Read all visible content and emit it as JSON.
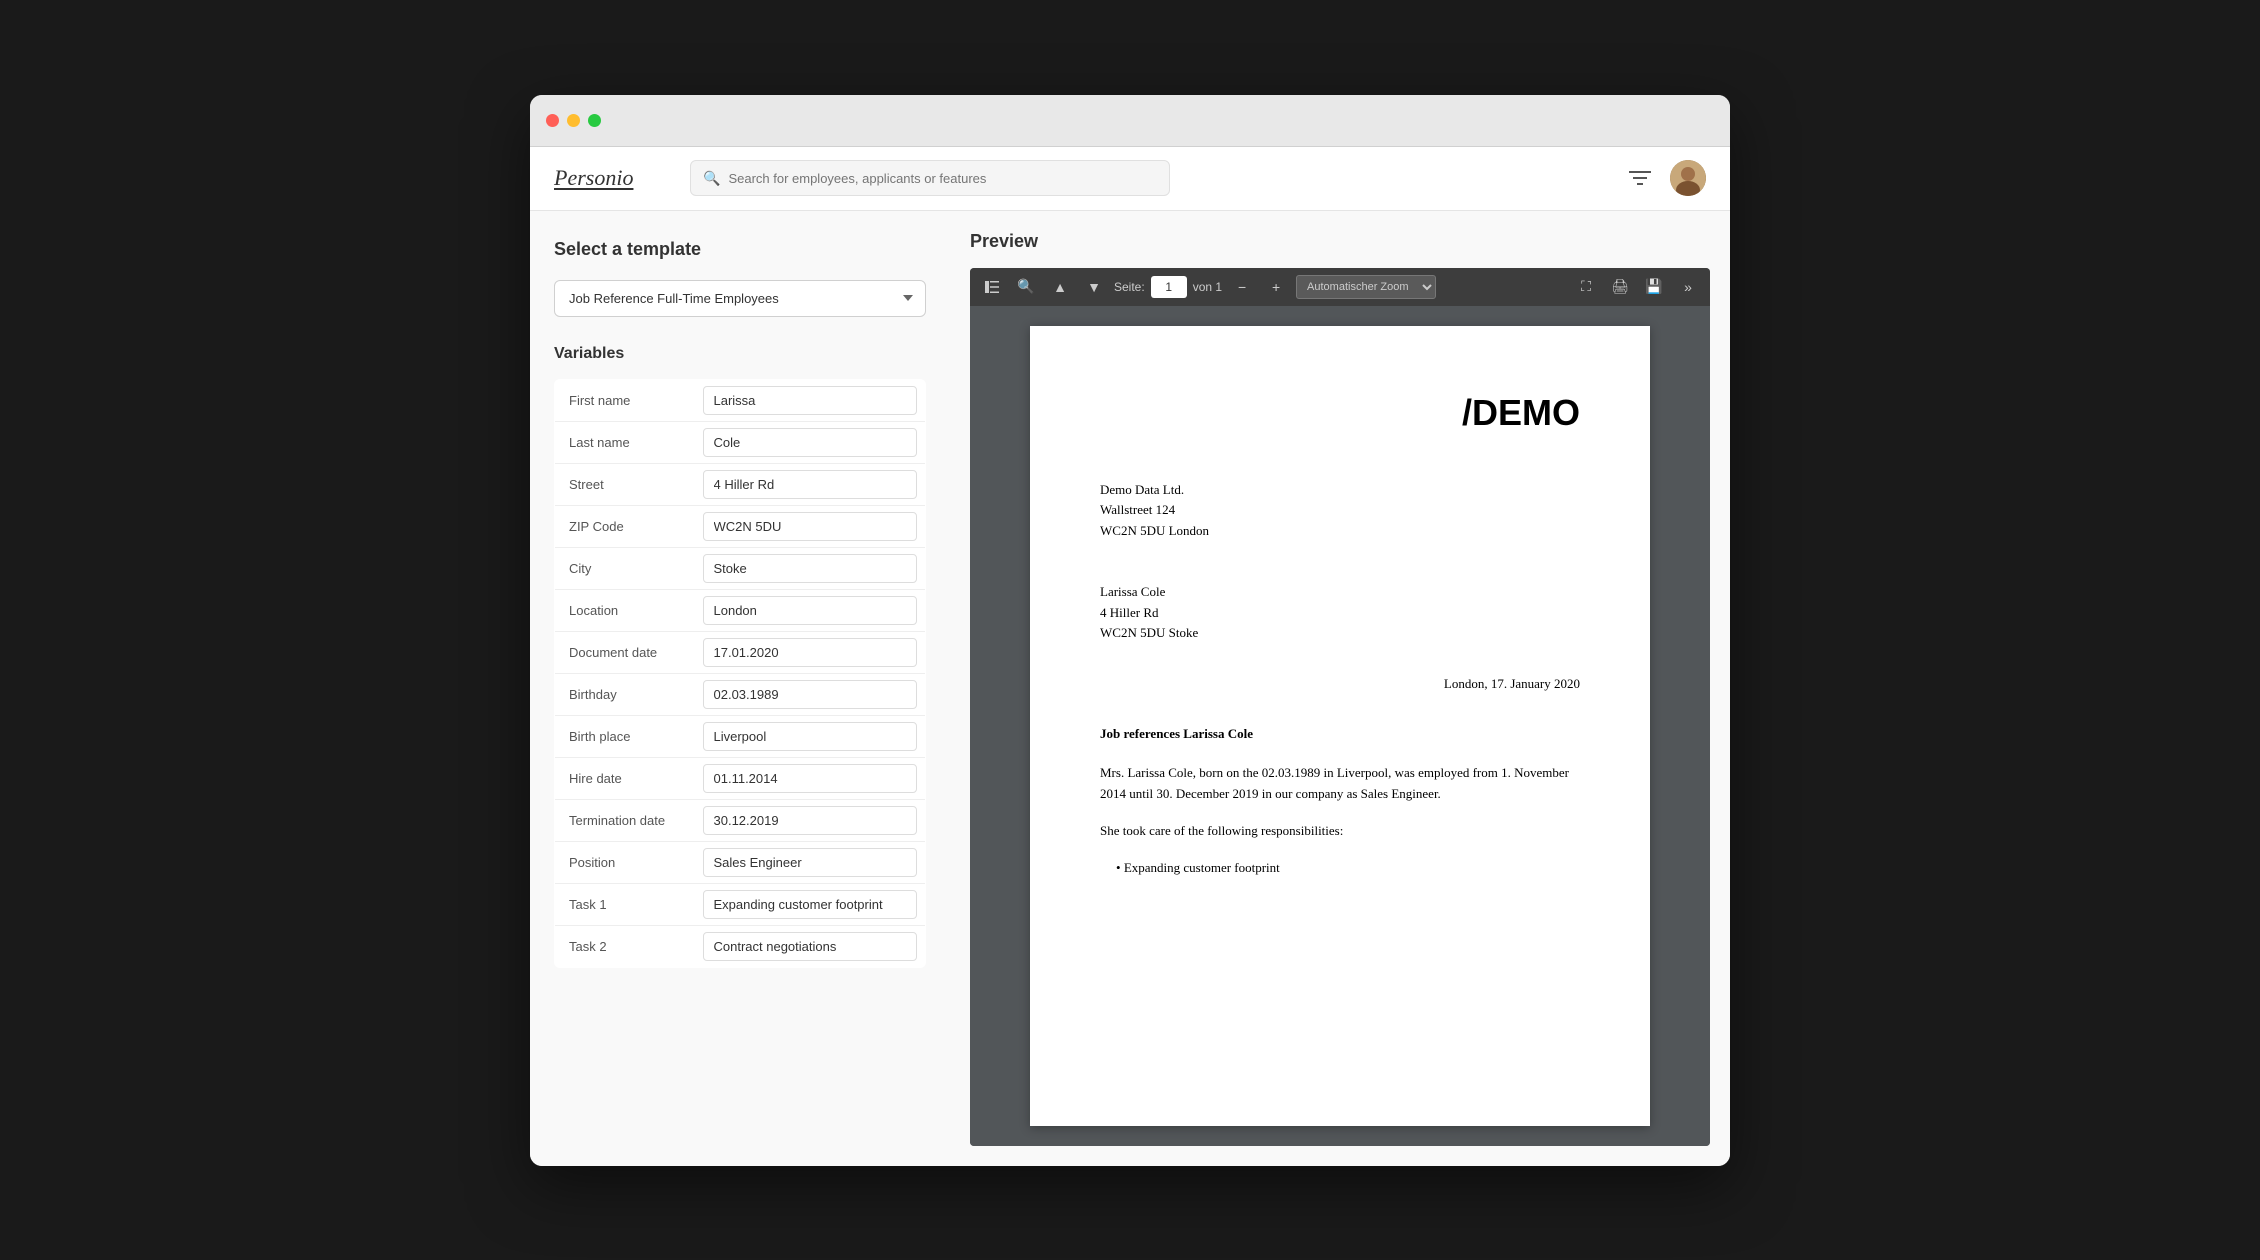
{
  "window": {
    "title": "Personio"
  },
  "header": {
    "logo": "Personio",
    "search_placeholder": "Search for employees, applicants or features"
  },
  "left_panel": {
    "select_template_label": "Select a template",
    "template_options": [
      "Job Reference Full-Time Employees"
    ],
    "selected_template": "Job Reference Full-Time Employees",
    "variables_label": "Variables",
    "variables": [
      {
        "label": "First name",
        "value": "Larissa"
      },
      {
        "label": "Last name",
        "value": "Cole"
      },
      {
        "label": "Street",
        "value": "4 Hiller Rd"
      },
      {
        "label": "ZIP Code",
        "value": "WC2N 5DU"
      },
      {
        "label": "City",
        "value": "Stoke"
      },
      {
        "label": "Location",
        "value": "London"
      },
      {
        "label": "Document date",
        "value": "17.01.2020"
      },
      {
        "label": "Birthday",
        "value": "02.03.1989"
      },
      {
        "label": "Birth place",
        "value": "Liverpool"
      },
      {
        "label": "Hire date",
        "value": "01.11.2014"
      },
      {
        "label": "Termination date",
        "value": "30.12.2019"
      },
      {
        "label": "Position",
        "value": "Sales Engineer"
      },
      {
        "label": "Task 1",
        "value": "Expanding customer footprint"
      },
      {
        "label": "Task 2",
        "value": "Contract negotiations"
      }
    ]
  },
  "preview": {
    "title": "Preview",
    "toolbar": {
      "page_label": "Seite:",
      "page_current": "1",
      "page_of": "von 1",
      "zoom_label": "Automatischer Zoom"
    },
    "pdf": {
      "company_logo": "/DEMO",
      "company_name": "Demo Data Ltd.",
      "company_street": "Wallstreet 124",
      "company_city": "WC2N 5DU London",
      "recipient_name": "Larissa Cole",
      "recipient_street": "4 Hiller Rd",
      "recipient_city": "WC2N 5DU Stoke",
      "date_line": "London, 17. January 2020",
      "subject": "Job references Larissa Cole",
      "body1": "Mrs. Larissa Cole, born on the 02.03.1989 in Liverpool, was employed from 1. November 2014 until 30. December 2019 in our company as Sales Engineer.",
      "responsibilities_intro": "She took care of the following responsibilities:",
      "task1_preview": "Expanding customer footprint"
    }
  }
}
